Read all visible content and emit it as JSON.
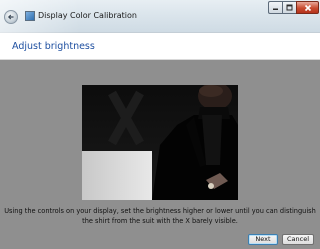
{
  "window": {
    "title": "Display Color Calibration",
    "icons": {
      "back": "back-arrow-icon",
      "app": "display-calibration-icon",
      "minimize": "minimize-icon",
      "maximize": "maximize-icon",
      "close": "close-icon"
    }
  },
  "page": {
    "title": "Adjust brightness",
    "title_color": "#1e4fa0"
  },
  "image": {
    "mark": "X",
    "description_icon": "calibration-reference-image"
  },
  "instructions": "Using the controls on your display, set the brightness higher or lower until you can distinguish the shirt from the suit with the X barely visible.",
  "buttons": {
    "next": "Next",
    "cancel": "Cancel"
  }
}
